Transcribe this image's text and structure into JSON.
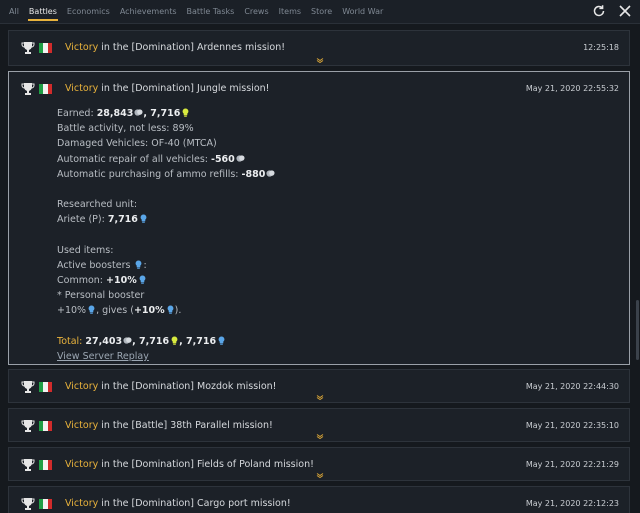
{
  "tabs": [
    {
      "label": "All",
      "active": false
    },
    {
      "label": "Battles",
      "active": true
    },
    {
      "label": "Economics",
      "active": false
    },
    {
      "label": "Achievements",
      "active": false
    },
    {
      "label": "Battle Tasks",
      "active": false
    },
    {
      "label": "Crews",
      "active": false
    },
    {
      "label": "Items",
      "active": false
    },
    {
      "label": "Store",
      "active": false
    },
    {
      "label": "World War",
      "active": false
    }
  ],
  "icons": {
    "refresh": "refresh-icon",
    "close": "close-icon",
    "trophy": "trophy-icon",
    "flag": "italy-flag-icon",
    "silver": "silver-lions-icon",
    "rp": "research-points-icon",
    "gold": "golden-eagles-icon"
  },
  "colors": {
    "accent": "#e8b23c",
    "flag_green": "#1f9e45",
    "flag_white": "#f2f2f2",
    "flag_red": "#d12b2b"
  },
  "messages": [
    {
      "victory": "Victory",
      "text": " in the [Domination] Ardennes mission!",
      "time": "12:25:18"
    },
    {
      "victory": "Victory",
      "text": " in the [Domination] Jungle mission!",
      "time": "May 21, 2020 22:55:32"
    },
    {
      "victory": "Victory",
      "text": " in the [Domination] Mozdok mission!",
      "time": "May 21, 2020 22:44:30"
    },
    {
      "victory": "Victory",
      "text": " in the [Battle] 38th Parallel mission!",
      "time": "May 21, 2020 22:35:10"
    },
    {
      "victory": "Victory",
      "text": " in the [Domination] Fields of Poland mission!",
      "time": "May 21, 2020 22:21:29"
    },
    {
      "victory": "Victory",
      "text": " in the [Domination] Cargo port mission!",
      "time": "May 21, 2020 22:12:23"
    }
  ],
  "details": {
    "earned_label": "Earned: ",
    "earned_silver": "28,843",
    "earned_sep": ", ",
    "earned_rp": "7,716",
    "activity": "Battle activity, not less: 89%",
    "damaged": "Damaged Vehicles: OF-40 (MTCA)",
    "repair_label": "Automatic repair of all vehicles: ",
    "repair_value": "-560",
    "ammo_label": "Automatic purchasing of ammo refills: ",
    "ammo_value": "-880",
    "researched_label": "Researched unit:",
    "unit_label": "Ariete (P): ",
    "unit_value": "7,716",
    "used_items_label": "Used items:",
    "boosters_label": "Active boosters ",
    "boosters_colon": ":",
    "common_label": "Common: ",
    "common_value": "+10%",
    "personal": "* Personal booster",
    "plus_pct": "+10%",
    "gives_label": ", gives (",
    "gives_value": "+10%",
    "gives_end": ").",
    "total_label": "Total: ",
    "total_silver": "27,403",
    "total_sep1": ", ",
    "total_rp": "7,716",
    "total_sep2": ", ",
    "total_crp": "7,716",
    "replay_link": "View Server Replay"
  }
}
